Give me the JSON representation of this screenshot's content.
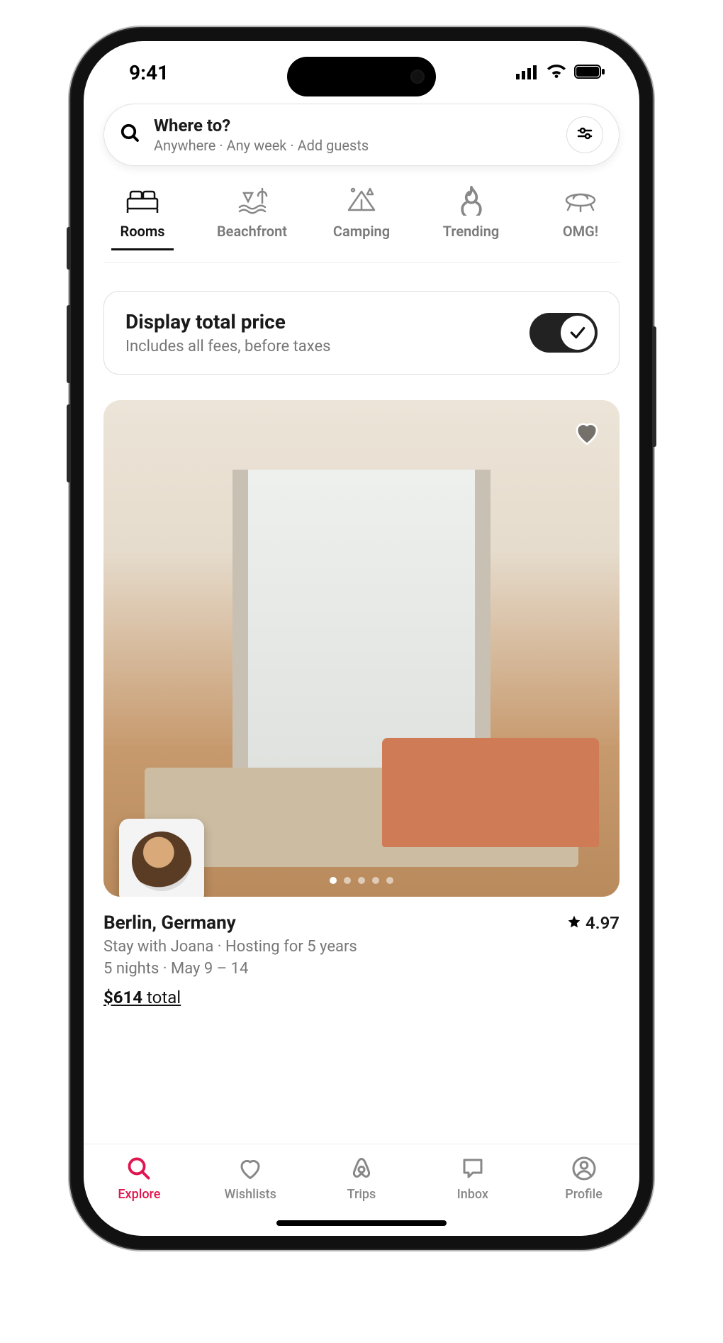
{
  "status": {
    "time": "9:41"
  },
  "search": {
    "title": "Where to?",
    "subtitle": "Anywhere · Any week · Add guests"
  },
  "categories": [
    {
      "label": "Rooms",
      "icon": "bed-icon",
      "active": true
    },
    {
      "label": "Beachfront",
      "icon": "beachfront-icon",
      "active": false
    },
    {
      "label": "Camping",
      "icon": "camping-icon",
      "active": false
    },
    {
      "label": "Trending",
      "icon": "trending-icon",
      "active": false
    },
    {
      "label": "OMG!",
      "icon": "omg-icon",
      "active": false
    }
  ],
  "priceToggle": {
    "title": "Display total price",
    "subtitle": "Includes all fees, before taxes",
    "on": true
  },
  "listing": {
    "location": "Berlin, Germany",
    "rating": "4.97",
    "host_line": "Stay with Joana · Hosting for 5 years",
    "stay_line": "5 nights · May 9 – 14",
    "price_amount": "$614",
    "price_suffix": "total",
    "image_count": 5,
    "image_index": 0
  },
  "tabs": [
    {
      "label": "Explore",
      "icon": "search-icon",
      "active": true
    },
    {
      "label": "Wishlists",
      "icon": "heart-icon",
      "active": false
    },
    {
      "label": "Trips",
      "icon": "airbnb-icon",
      "active": false
    },
    {
      "label": "Inbox",
      "icon": "chat-icon",
      "active": false
    },
    {
      "label": "Profile",
      "icon": "profile-icon",
      "active": false
    }
  ]
}
